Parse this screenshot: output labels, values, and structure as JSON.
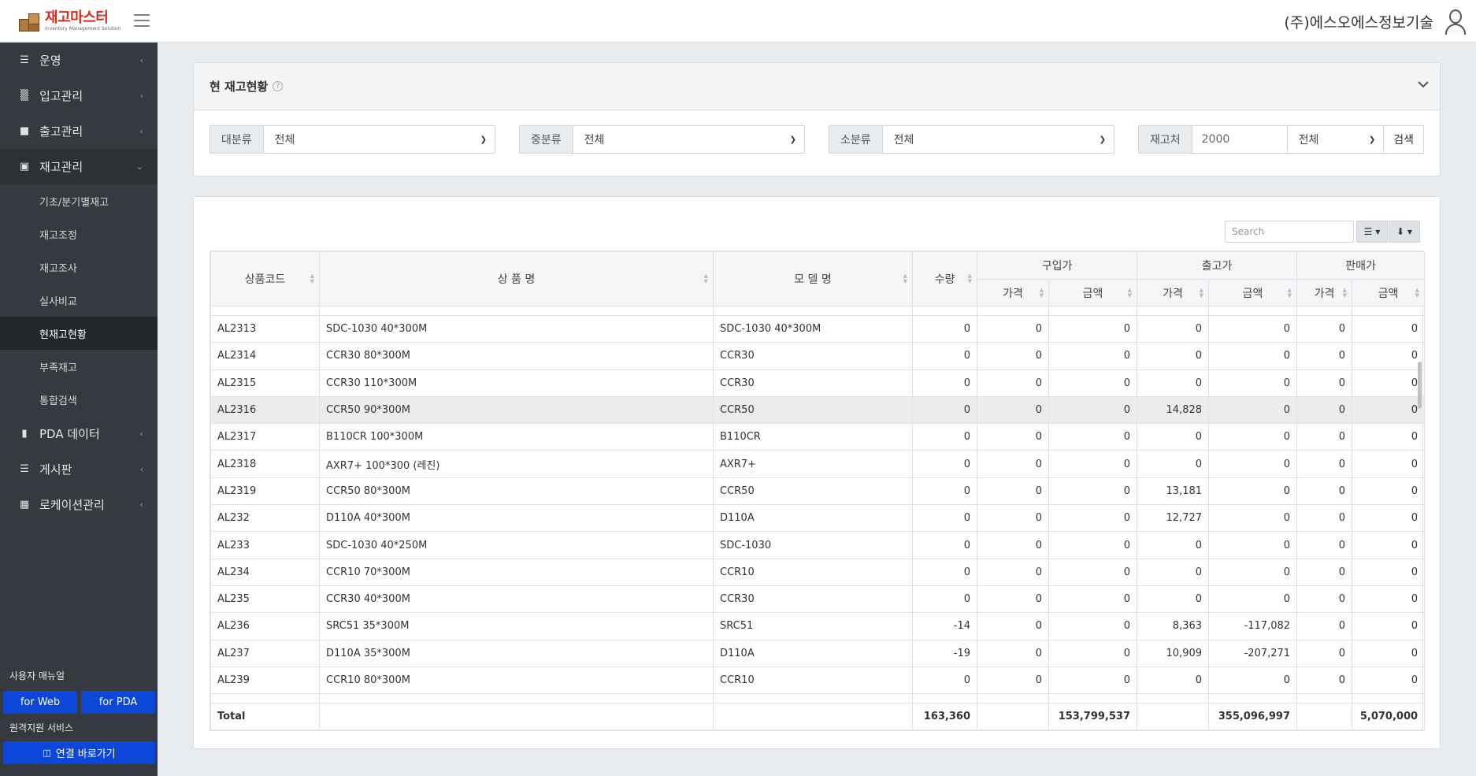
{
  "header": {
    "logo_title": "재고마스터",
    "logo_subtitle": "Inventory Management Solution",
    "company": "(주)에스오에스정보기술"
  },
  "sidebar": {
    "items": [
      {
        "label": "운영",
        "icon": "list-icon"
      },
      {
        "label": "입고관리",
        "icon": "factory-icon"
      },
      {
        "label": "출고관리",
        "icon": "truck-icon"
      },
      {
        "label": "재고관리",
        "icon": "share-icon"
      }
    ],
    "sub_items": [
      "기초/분기별재고",
      "재고조정",
      "재고조사",
      "실사비교",
      "현재고현황",
      "부족재고",
      "통합검색"
    ],
    "items_after": [
      {
        "label": "PDA 데이터",
        "icon": "book-icon"
      },
      {
        "label": "게시판",
        "icon": "bars-icon"
      },
      {
        "label": "로케이션관리",
        "icon": "grid-icon"
      }
    ],
    "manual_label": "사용자 매뉴얼",
    "web_btn": "for Web",
    "pda_btn": "for PDA",
    "remote_label": "원격지원 서비스",
    "connect_btn": "연결 바로가기"
  },
  "filter_card": {
    "title": "현 재고현황",
    "filters": [
      {
        "label": "대분류",
        "value": "전체"
      },
      {
        "label": "중분류",
        "value": "전체"
      },
      {
        "label": "소분류",
        "value": "전체"
      }
    ],
    "stock_label": "재고처",
    "stock_value": "2000",
    "stock_select": "전체",
    "search_btn": "검색"
  },
  "table": {
    "search_placeholder": "Search",
    "headers": {
      "code": "상품코드",
      "name": "상 품 명",
      "model": "모 델 명",
      "qty": "수량",
      "purchase": "구입가",
      "outgoing": "출고가",
      "sale": "판매가",
      "price": "가격",
      "amount": "금액"
    },
    "rows": [
      {
        "code": "AL2313",
        "name": "SDC-1030 40*300M",
        "model": "SDC-1030 40*300M",
        "qty": "0",
        "p_price": "0",
        "p_amt": "0",
        "o_price": "0",
        "o_amt": "0",
        "s_price": "0",
        "s_amt": "0"
      },
      {
        "code": "AL2314",
        "name": "CCR30 80*300M",
        "model": "CCR30",
        "qty": "0",
        "p_price": "0",
        "p_amt": "0",
        "o_price": "0",
        "o_amt": "0",
        "s_price": "0",
        "s_amt": "0"
      },
      {
        "code": "AL2315",
        "name": "CCR30 110*300M",
        "model": "CCR30",
        "qty": "0",
        "p_price": "0",
        "p_amt": "0",
        "o_price": "0",
        "o_amt": "0",
        "s_price": "0",
        "s_amt": "0"
      },
      {
        "code": "AL2316",
        "name": "CCR50 90*300M",
        "model": "CCR50",
        "qty": "0",
        "p_price": "0",
        "p_amt": "0",
        "o_price": "14,828",
        "o_amt": "0",
        "s_price": "0",
        "s_amt": "0"
      },
      {
        "code": "AL2317",
        "name": "B110CR 100*300M",
        "model": "B110CR",
        "qty": "0",
        "p_price": "0",
        "p_amt": "0",
        "o_price": "0",
        "o_amt": "0",
        "s_price": "0",
        "s_amt": "0"
      },
      {
        "code": "AL2318",
        "name": "AXR7+ 100*300 (레진)",
        "model": "AXR7+",
        "qty": "0",
        "p_price": "0",
        "p_amt": "0",
        "o_price": "0",
        "o_amt": "0",
        "s_price": "0",
        "s_amt": "0"
      },
      {
        "code": "AL2319",
        "name": "CCR50 80*300M",
        "model": "CCR50",
        "qty": "0",
        "p_price": "0",
        "p_amt": "0",
        "o_price": "13,181",
        "o_amt": "0",
        "s_price": "0",
        "s_amt": "0"
      },
      {
        "code": "AL232",
        "name": "D110A 40*300M",
        "model": "D110A",
        "qty": "0",
        "p_price": "0",
        "p_amt": "0",
        "o_price": "12,727",
        "o_amt": "0",
        "s_price": "0",
        "s_amt": "0"
      },
      {
        "code": "AL233",
        "name": "SDC-1030 40*250M",
        "model": "SDC-1030",
        "qty": "0",
        "p_price": "0",
        "p_amt": "0",
        "o_price": "0",
        "o_amt": "0",
        "s_price": "0",
        "s_amt": "0"
      },
      {
        "code": "AL234",
        "name": "CCR10 70*300M",
        "model": "CCR10",
        "qty": "0",
        "p_price": "0",
        "p_amt": "0",
        "o_price": "0",
        "o_amt": "0",
        "s_price": "0",
        "s_amt": "0"
      },
      {
        "code": "AL235",
        "name": "CCR30 40*300M",
        "model": "CCR30",
        "qty": "0",
        "p_price": "0",
        "p_amt": "0",
        "o_price": "0",
        "o_amt": "0",
        "s_price": "0",
        "s_amt": "0"
      },
      {
        "code": "AL236",
        "name": "SRC51 35*300M",
        "model": "SRC51",
        "qty": "-14",
        "p_price": "0",
        "p_amt": "0",
        "o_price": "8,363",
        "o_amt": "-117,082",
        "s_price": "0",
        "s_amt": "0"
      },
      {
        "code": "AL237",
        "name": "D110A 35*300M",
        "model": "D110A",
        "qty": "-19",
        "p_price": "0",
        "p_amt": "0",
        "o_price": "10,909",
        "o_amt": "-207,271",
        "s_price": "0",
        "s_amt": "0"
      },
      {
        "code": "AL239",
        "name": "CCR10 80*300M",
        "model": "CCR10",
        "qty": "0",
        "p_price": "0",
        "p_amt": "0",
        "o_price": "0",
        "o_amt": "0",
        "s_price": "0",
        "s_amt": "0"
      }
    ],
    "total": {
      "label": "Total",
      "qty": "163,360",
      "p_amt": "153,799,537",
      "o_amt": "355,096,997",
      "s_amt": "5,070,000"
    }
  }
}
